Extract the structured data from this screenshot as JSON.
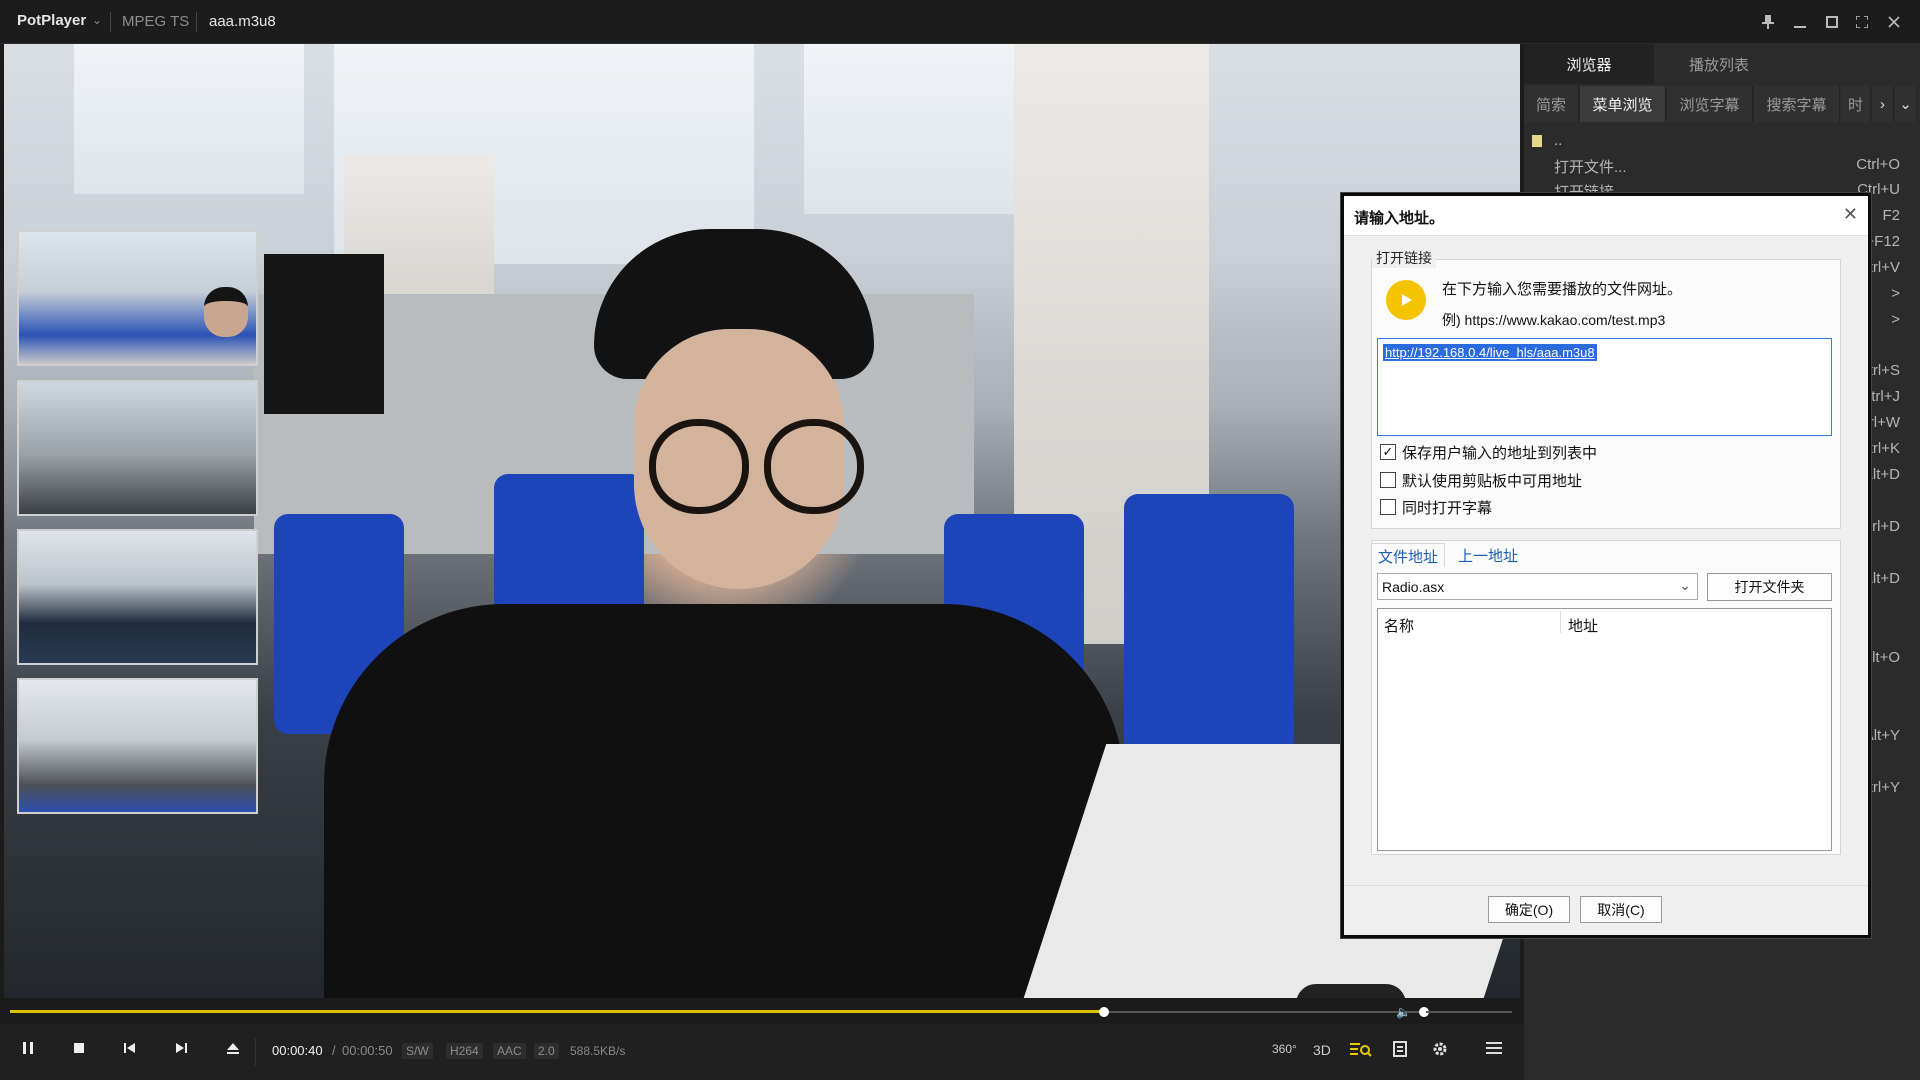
{
  "titlebar": {
    "app": "PotPlayer",
    "format": "MPEG TS",
    "file": "aaa.m3u8"
  },
  "sidebar": {
    "tabs": [
      "浏览器",
      "播放列表"
    ],
    "subtabs": [
      "简索",
      "菜单浏览",
      "浏览字幕",
      "搜索字幕",
      "时"
    ],
    "parent_dir": "..",
    "menu": [
      {
        "label": "打开文件...",
        "shortcut": "Ctrl+O"
      },
      {
        "label": "打开链接",
        "shortcut": "Ctrl+U"
      }
    ],
    "shortcuts_visible": [
      "F2",
      "+F12",
      "trl+V",
      ">",
      ">",
      "trl+S",
      "Ctrl+J",
      "trl+W",
      "trl+K",
      "Alt+D",
      "trl+D",
      "Alt+D",
      "Alt+O",
      "Alt+Y",
      "trl+Y"
    ]
  },
  "controls": {
    "current_time": "00:00:40",
    "separator": "/",
    "total_time": "00:00:50",
    "decoder": "S/W",
    "video_codec": "H264",
    "audio_codec": "AAC",
    "channels": "2.0",
    "speed": "588.5KB/s",
    "progress": 0.8,
    "volume": 0.1,
    "btn_360": "360°",
    "btn_3d": "3D"
  },
  "dialog": {
    "title": "请输入地址。",
    "group_label": "打开链接",
    "instruction": "在下方输入您需要播放的文件网址。",
    "example": "例) https://www.kakao.com/test.mp3",
    "url": "http://192.168.0.4/live_hls/aaa.m3u8",
    "options": [
      {
        "label": "保存用户输入的地址到列表中",
        "checked": "✓"
      },
      {
        "label": "默认使用剪贴板中可用地址",
        "checked": ""
      },
      {
        "label": "同时打开字幕",
        "checked": ""
      }
    ],
    "tabs": [
      "文件地址",
      "上一地址"
    ],
    "combo_value": "Radio.asx",
    "open_folder": "打开文件夹",
    "columns": [
      "名称",
      "地址"
    ],
    "ok": "确定(O)",
    "cancel": "取消(C)"
  },
  "colors": {
    "accent": "#ddc300",
    "selection": "#2b6be0",
    "play_badge": "#f5c400"
  }
}
